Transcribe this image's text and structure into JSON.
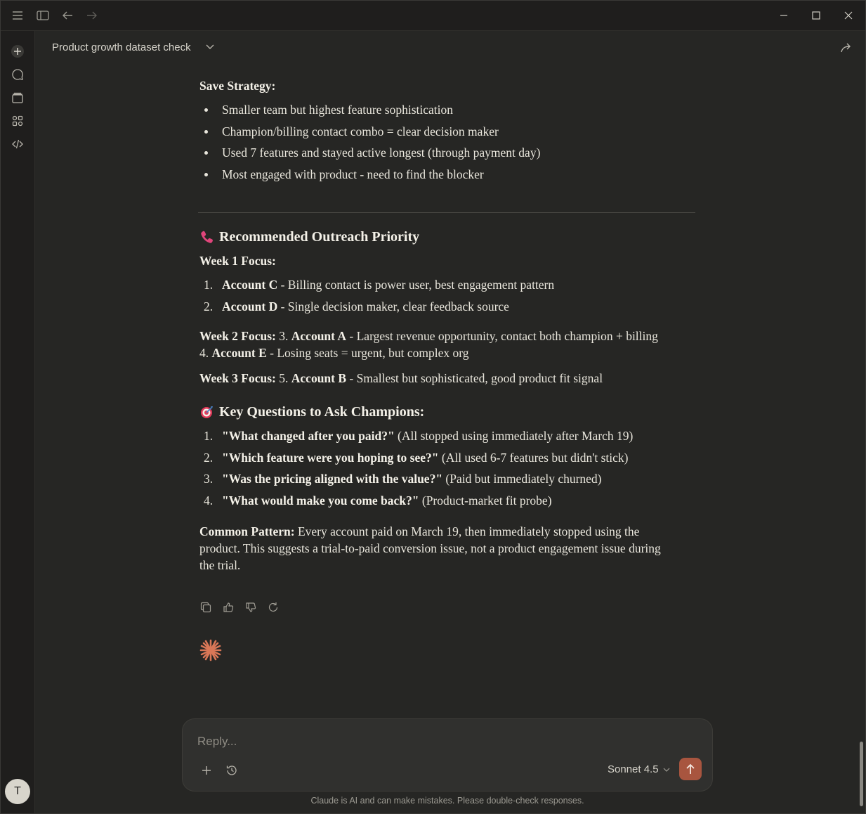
{
  "app": {
    "conversation_title": "Product growth dataset check"
  },
  "sidebar": {
    "icons": [
      "new-chat-icon",
      "chat-icon",
      "projects-icon",
      "artifacts-icon",
      "code-icon"
    ],
    "avatar_initial": "T"
  },
  "message": {
    "save_strategy_label": "Save Strategy:",
    "save_strategy_bullets": [
      "Smaller team but highest feature sophistication",
      "Champion/billing contact combo = clear decision maker",
      "Used 7 features and stayed active longest (through payment day)",
      "Most engaged with product - need to find the blocker"
    ],
    "outreach": {
      "emoji": "📞",
      "heading": "Recommended Outreach Priority",
      "week1_label": "Week 1 Focus:",
      "week1_items": [
        {
          "num": "1.",
          "account": "Account C",
          "text": " - Billing contact is power user, best engagement pattern"
        },
        {
          "num": "2.",
          "account": "Account D",
          "text": " - Single decision maker, clear feedback source"
        }
      ],
      "week2_label": "Week 2 Focus:",
      "week2_prefix3": " 3. ",
      "week2_account3": "Account A",
      "week2_text3": " - Largest revenue opportunity, contact both champion + billing",
      "week2_prefix4": "4. ",
      "week2_account4": "Account E",
      "week2_text4": " - Losing seats = urgent, but complex org",
      "week3_label": "Week 3 Focus:",
      "week3_prefix": " 5. ",
      "week3_account": "Account B",
      "week3_text": " - Smallest but sophisticated, good product fit signal"
    },
    "questions": {
      "emoji": "🎯",
      "heading": "Key Questions to Ask Champions:",
      "items": [
        {
          "num": "1.",
          "q": "\"What changed after you paid?\"",
          "note": " (All stopped using immediately after March 19)"
        },
        {
          "num": "2.",
          "q": "\"Which feature were you hoping to see?\"",
          "note": " (All used 6-7 features but didn't stick)"
        },
        {
          "num": "3.",
          "q": "\"Was the pricing aligned with the value?\"",
          "note": " (Paid but immediately churned)"
        },
        {
          "num": "4.",
          "q": "\"What would make you come back?\"",
          "note": " (Product-market fit probe)"
        }
      ]
    },
    "common_pattern_label": "Common Pattern:",
    "common_pattern_text": " Every account paid on March 19, then immediately stopped using the product. This suggests a trial-to-paid conversion issue, not a product engagement issue during the trial."
  },
  "composer": {
    "placeholder": "Reply...",
    "model": "Sonnet 4.5",
    "disclaimer": "Claude is AI and can make mistakes. Please double-check responses."
  },
  "colors": {
    "background": "#262624",
    "accent": "#a8553f",
    "spark": "#d97757"
  }
}
